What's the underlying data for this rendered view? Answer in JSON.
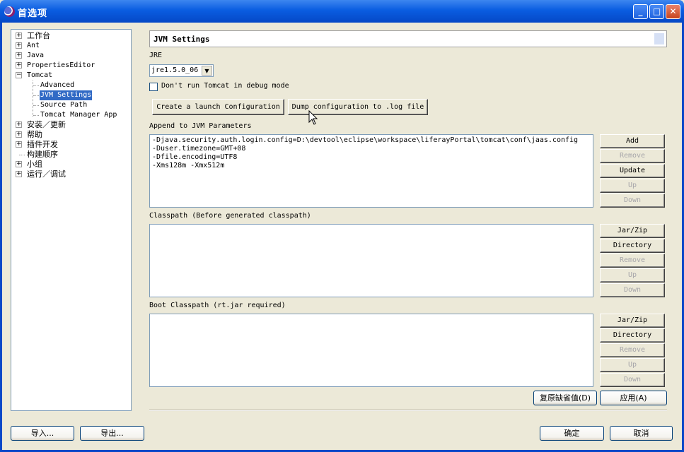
{
  "window": {
    "title": "首选项",
    "controls": [
      "minimize",
      "maximize",
      "close"
    ]
  },
  "tree": {
    "items": [
      {
        "label": "工作台",
        "expander": "+",
        "level": 0
      },
      {
        "label": "Ant",
        "expander": "+",
        "level": 0
      },
      {
        "label": "Java",
        "expander": "+",
        "level": 0
      },
      {
        "label": "PropertiesEditor",
        "expander": "+",
        "level": 0
      },
      {
        "label": "Tomcat",
        "expander": "-",
        "level": 0
      },
      {
        "label": "Advanced",
        "expander": "",
        "level": 1
      },
      {
        "label": "JVM Settings",
        "expander": "",
        "level": 1,
        "selected": true
      },
      {
        "label": "Source Path",
        "expander": "",
        "level": 1
      },
      {
        "label": "Tomcat Manager App",
        "expander": "",
        "level": 1
      },
      {
        "label": "安装／更新",
        "expander": "+",
        "level": 0
      },
      {
        "label": "帮助",
        "expander": "+",
        "level": 0
      },
      {
        "label": "插件开发",
        "expander": "+",
        "level": 0
      },
      {
        "label": "构建顺序",
        "expander": "",
        "level": 0
      },
      {
        "label": "小组",
        "expander": "+",
        "level": 0
      },
      {
        "label": "运行／调试",
        "expander": "+",
        "level": 0
      }
    ]
  },
  "page": {
    "title": "JVM Settings",
    "jre_label": "JRE",
    "jre_value": "jre1.5.0_06",
    "debug_checkbox_label": "Don't run Tomcat in debug mode",
    "debug_checked": false,
    "create_launch_button": "Create a launch Configuration",
    "dump_config_button": "Dump configuration to .log file",
    "jvm_params_label": "Append to JVM Parameters",
    "jvm_params": [
      "-Djava.security.auth.login.config=D:\\devtool\\eclipse\\workspace\\liferayPortal\\tomcat\\conf\\jaas.config",
      "-Duser.timezone=GMT+08",
      "-Dfile.encoding=UTF8",
      "-Xms128m -Xmx512m"
    ],
    "jvm_buttons": [
      "Add",
      "Remove",
      "Update",
      "Up",
      "Down"
    ],
    "classpath_label": "Classpath (Before generated classpath)",
    "classpath_buttons": [
      "Jar/Zip",
      "Directory",
      "Remove",
      "Up",
      "Down"
    ],
    "boot_classpath_label": "Boot Classpath (rt.jar required)",
    "boot_classpath_buttons": [
      "Jar/Zip",
      "Directory",
      "Remove",
      "Up",
      "Down"
    ],
    "restore_defaults_button": "复原缺省值(D)",
    "apply_button": "应用(A)"
  },
  "footer": {
    "import_button": "导入...",
    "export_button": "导出...",
    "ok_button": "确定",
    "cancel_button": "取消"
  },
  "colors": {
    "titlebar": "#0a5de1",
    "selection": "#316ac5",
    "dialog_bg": "#ece9d8",
    "disabled_text": "#a7a6aa"
  }
}
